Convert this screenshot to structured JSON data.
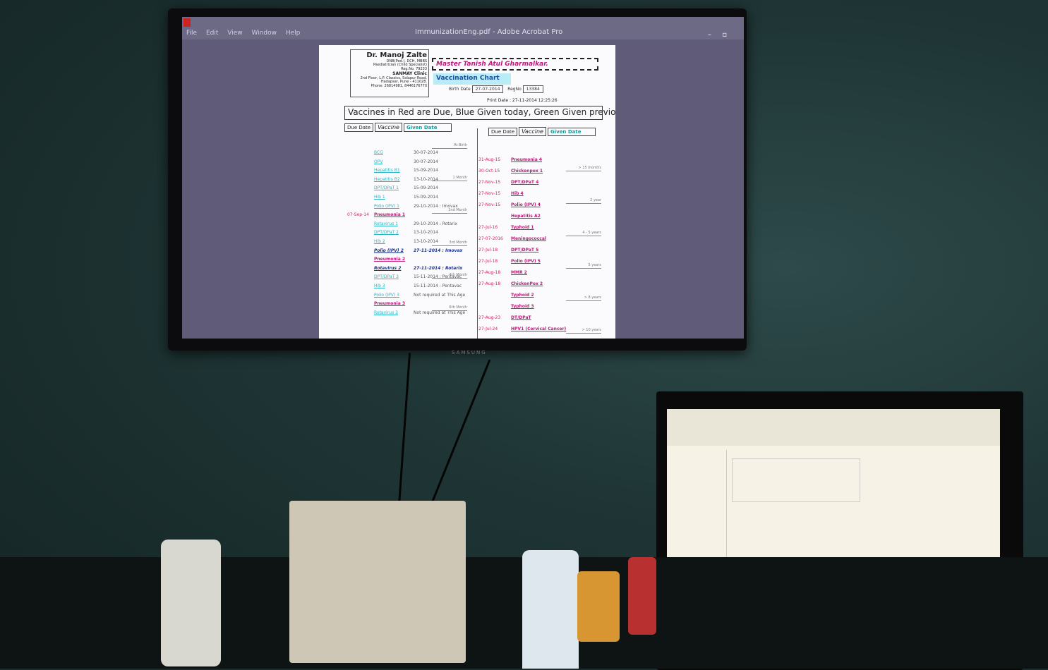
{
  "tv": {
    "window_title": "ImmunizationEng.pdf - Adobe Acrobat Pro",
    "menu": [
      "File",
      "Edit",
      "View",
      "Window",
      "Help"
    ],
    "brand": "SAMSUNG"
  },
  "document": {
    "doctor_name": "Dr. Manoj Zalte",
    "doctor_lines": [
      "DNB(Ped.), DCH, MBBS",
      "Paediatrician (Child Specialist)",
      "Reg.No. 79233",
      "SANMAY Clinic",
      "2nd Floor, L.P. Classics, Solapur Road,",
      "Hadapsar, Pune - 411028.",
      "Phone: 26814981, 8446176770"
    ],
    "patient_name": "Master Tanish Atul Gharmalkar.",
    "chart_title": "Vaccination Chart",
    "birth_label": "Birth Date",
    "birth_date": "27-07-2014",
    "reg_label": "RegNo",
    "reg_no": "13384",
    "print_date": "Print Date : 27-11-2014 12:25:26",
    "banner": "Vaccines in Red are Due, Blue Given today, Green Given previously.",
    "headers": {
      "due": "Due Date",
      "vaccine": "Vaccine",
      "given": "Given Date"
    },
    "left_rows": [
      {
        "due": "",
        "vaccine": "BCG",
        "given": "30-07-2014",
        "kind": "green"
      },
      {
        "due": "",
        "vaccine": "OPV",
        "given": "30-07-2014",
        "kind": "green"
      },
      {
        "due": "",
        "vaccine": "Hepatitis B1",
        "given": "15-09-2014",
        "kind": "green"
      },
      {
        "due": "",
        "vaccine": "Hepatitis B2",
        "given": "13-10-2014",
        "kind": "green"
      },
      {
        "due": "",
        "vaccine": "DPT/DPaT 1",
        "given": "15-09-2014",
        "kind": "green"
      },
      {
        "due": "",
        "vaccine": "Hib 1",
        "given": "15-09-2014",
        "kind": "green"
      },
      {
        "due": "",
        "vaccine": "Polio (IPV) 1",
        "given": "29-10-2014 : Imovax",
        "kind": "green"
      },
      {
        "due": "07-Sep-14",
        "vaccine": "Pneumonia 1",
        "given": "",
        "kind": "red"
      },
      {
        "due": "",
        "vaccine": "Rotavirus 1",
        "given": "29-10-2014 : Rotarix",
        "kind": "green"
      },
      {
        "due": "",
        "vaccine": "DPT/DPaT 2",
        "given": "13-10-2014",
        "kind": "green"
      },
      {
        "due": "",
        "vaccine": "Hib 2",
        "given": "13-10-2014",
        "kind": "green"
      },
      {
        "due": "",
        "vaccine": "Polio (IPV) 2",
        "given": "27-11-2014 : Imovax",
        "kind": "blue"
      },
      {
        "due": "",
        "vaccine": "Pneumonia 2",
        "given": "",
        "kind": "red"
      },
      {
        "due": "",
        "vaccine": "Rotavirus 2",
        "given": "27-11-2014 : Rotarix",
        "kind": "blue"
      },
      {
        "due": "",
        "vaccine": "DPT/DPaT 3",
        "given": "15-11-2014 : Pentavac",
        "kind": "green"
      },
      {
        "due": "",
        "vaccine": "Hib 3",
        "given": "15-11-2014 : Pentavac",
        "kind": "green"
      },
      {
        "due": "",
        "vaccine": "Polio (IPV) 3",
        "given": "Not required at This Age",
        "kind": "green"
      },
      {
        "due": "",
        "vaccine": "Pneumonia 3",
        "given": "",
        "kind": "red"
      },
      {
        "due": "",
        "vaccine": "Rotavirus 3",
        "given": "Not required at This Age",
        "kind": "green"
      }
    ],
    "left_sections": [
      "At Birth",
      "1 Month",
      "2nd Month",
      "3rd Month",
      "4th Month",
      "6th Month"
    ],
    "right_rows": [
      {
        "due": "31-Aug-15",
        "vaccine": "Pneumonia 4"
      },
      {
        "due": "30-Oct-15",
        "vaccine": "Chickenpox 1"
      },
      {
        "due": "27-Nov-15",
        "vaccine": "DPT/DPaT 4"
      },
      {
        "due": "27-Nov-15",
        "vaccine": "Hib 4"
      },
      {
        "due": "27-Nov-15",
        "vaccine": "Polio (IPV) 4"
      },
      {
        "due": "",
        "vaccine": "Hepatitis A2"
      },
      {
        "due": "27-Jul-16",
        "vaccine": "Typhoid 1"
      },
      {
        "due": "27-07-2016",
        "vaccine": "Meningococcal"
      },
      {
        "due": "27-Jul-18",
        "vaccine": "DPT/DPaT 5"
      },
      {
        "due": "27-Jul-18",
        "vaccine": "Polio (IPV) 5"
      },
      {
        "due": "27-Aug-18",
        "vaccine": "MMR 2"
      },
      {
        "due": "27-Aug-18",
        "vaccine": "ChickenPox 2"
      },
      {
        "due": "",
        "vaccine": "Typhoid 2"
      },
      {
        "due": "",
        "vaccine": "Typhoid 3"
      },
      {
        "due": "27-Aug-23",
        "vaccine": "DT/DPaT"
      },
      {
        "due": "27-Jul-24",
        "vaccine": "HPV1 (Cervical Cancer)"
      }
    ],
    "right_sections": [
      "> 15 months",
      "2 year",
      "4 - 5 years",
      "5 years",
      "> 8 years",
      "> 10 years"
    ]
  },
  "colors": {
    "due_red": "#d0245a",
    "given_blue": "#1a2f88",
    "given_green": "#27b7c4",
    "patient_magenta": "#c0187a"
  }
}
